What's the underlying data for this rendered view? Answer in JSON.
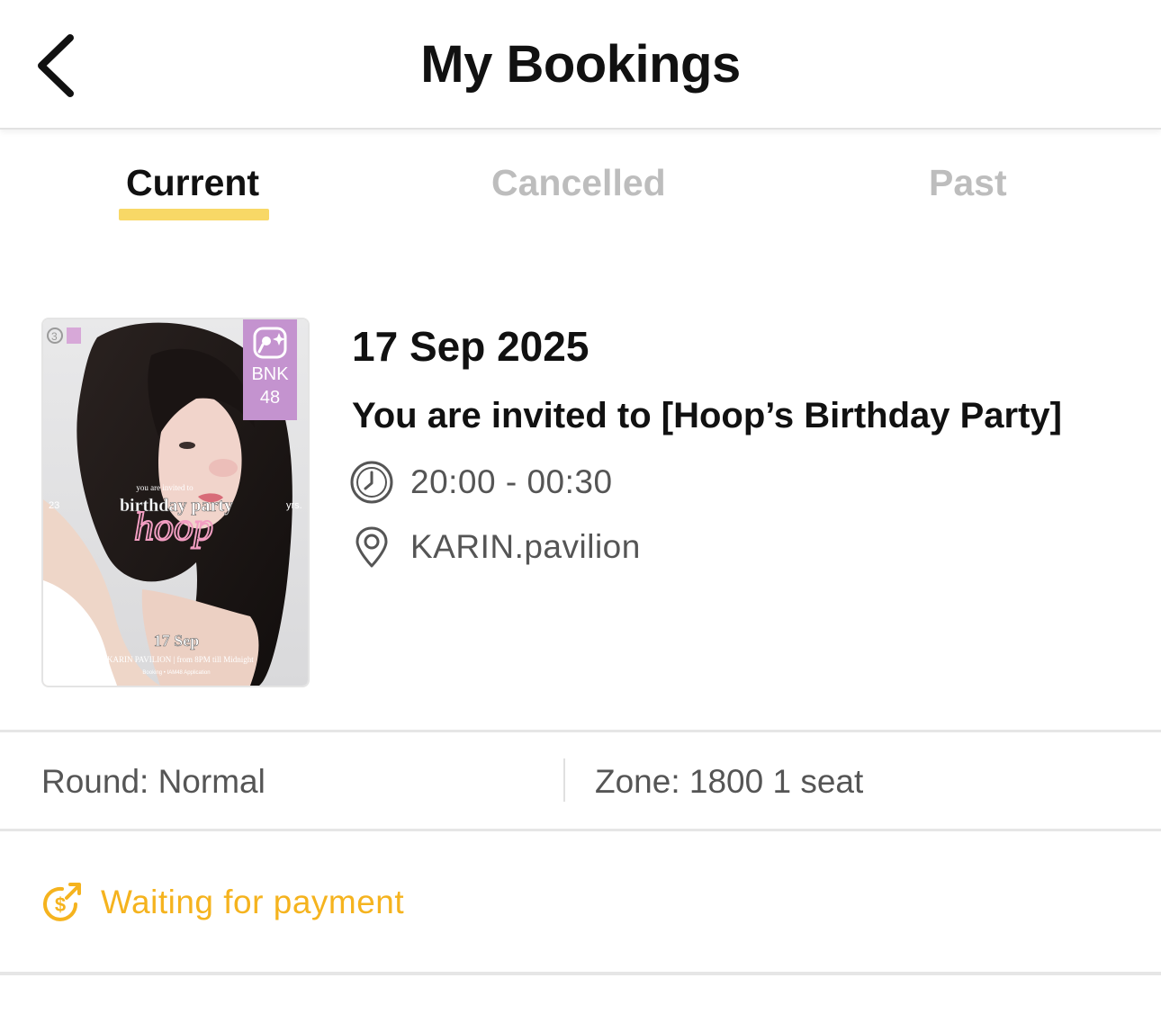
{
  "header": {
    "title": "My Bookings",
    "back_icon": "chevron-left-icon"
  },
  "tabs": [
    {
      "label": "Current",
      "active": true
    },
    {
      "label": "Cancelled",
      "active": false
    },
    {
      "label": "Past",
      "active": false
    }
  ],
  "accent_color": "#f8d866",
  "booking": {
    "poster": {
      "badge": {
        "line1": "BNK",
        "line2": "48",
        "icon": "microphone-sparkle-icon",
        "color": "#c493cf"
      },
      "invite_text": "you are invited to",
      "headline": "birthday party",
      "script_name": "hoop",
      "age_left": "23",
      "age_right": "yrs.",
      "date": "17 Sep",
      "venue_line": "at KARIN PAVILION | from 8PM till Midnight",
      "footer_line": "Booking • IAM48 Application"
    },
    "date": "17 Sep 2025",
    "event_name": "You are invited to [Hoop’s Birthday Party]",
    "time": "20:00 - 00:30",
    "time_icon": "clock-icon",
    "venue": "KARIN.pavilion",
    "venue_icon": "location-pin-icon",
    "round": "Round: Normal",
    "zone": "Zone: 1800 1 seat",
    "status": "Waiting for payment",
    "status_icon": "dollar-arrow-icon",
    "status_color": "#f5b31e"
  }
}
